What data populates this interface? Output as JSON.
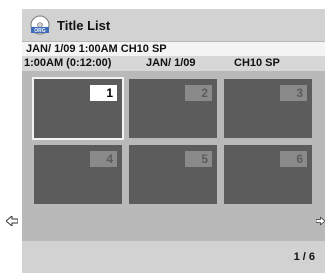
{
  "header": {
    "title": "Title List",
    "icon": "disc-orig-icon",
    "icon_text": "ORG"
  },
  "info_line_1": "JAN/ 1/09 1:00AM  CH10  SP",
  "info_line_2": {
    "time": "1:00AM (0:12:00)",
    "date": "JAN/  1/09",
    "channel": "CH10 SP"
  },
  "thumbnails": [
    {
      "number": "1",
      "selected": true
    },
    {
      "number": "2",
      "selected": false
    },
    {
      "number": "3",
      "selected": false
    },
    {
      "number": "4",
      "selected": false
    },
    {
      "number": "5",
      "selected": false
    },
    {
      "number": "6",
      "selected": false
    }
  ],
  "pagination": {
    "page": "1 / 6"
  },
  "nav": {
    "left_icon": "left-arrow-icon",
    "right_icon": "right-arrow-icon"
  }
}
